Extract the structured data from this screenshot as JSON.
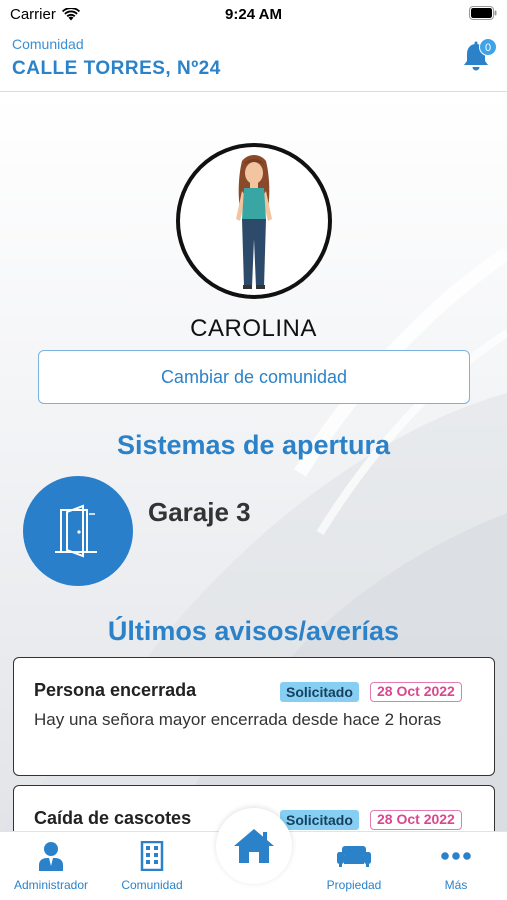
{
  "status_bar": {
    "carrier": "Carrier",
    "time": "9:24 AM"
  },
  "header": {
    "label": "Comunidad",
    "title": "CALLE TORRES, Nº24",
    "notifications_count": "0"
  },
  "profile": {
    "name": "CAROLINA",
    "change_button": "Cambiar de comunidad"
  },
  "opening_systems": {
    "title": "Sistemas de apertura",
    "items": [
      {
        "label": "Garaje 3",
        "icon": "door-open-icon"
      }
    ]
  },
  "notices": {
    "title": "Últimos avisos/averías",
    "items": [
      {
        "title": "Persona encerrada",
        "status": "Solicitado",
        "date": "28 Oct 2022",
        "description": "Hay una señora mayor encerrada desde hace 2 horas"
      },
      {
        "title": "Caída de cascotes",
        "status": "Solicitado",
        "date": "28 Oct 2022",
        "description": ""
      }
    ]
  },
  "tabbar": {
    "tabs": [
      {
        "label": "Administrador",
        "icon": "user-icon"
      },
      {
        "label": "Comunidad",
        "icon": "building-icon"
      },
      {
        "label": "Propiedad",
        "icon": "sofa-icon"
      },
      {
        "label": "Más",
        "icon": "more-icon"
      }
    ],
    "home_icon": "home-icon"
  },
  "colors": {
    "primary": "#2c82c9",
    "status_badge": "#86cff2",
    "date_badge": "#d9478f"
  }
}
